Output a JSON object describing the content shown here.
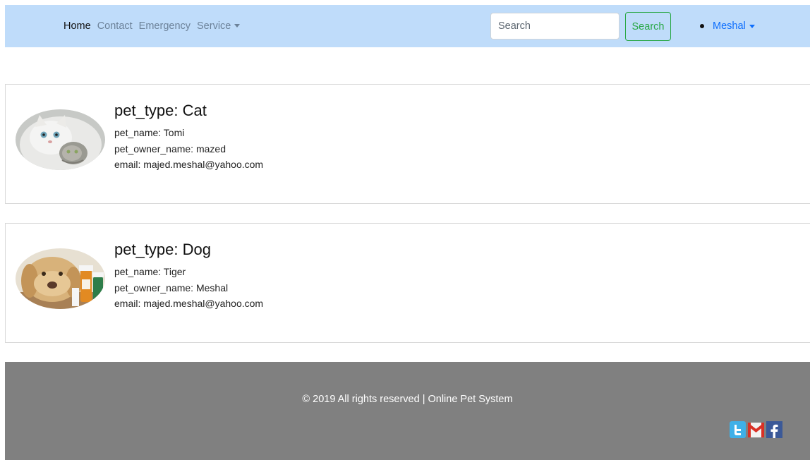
{
  "navbar": {
    "links": [
      {
        "label": "Home"
      },
      {
        "label": "Contact"
      },
      {
        "label": "Emergency"
      },
      {
        "label": "Service"
      }
    ],
    "search": {
      "placeholder": "Search",
      "button_label": "Search"
    },
    "user": {
      "name": "Meshal"
    }
  },
  "pets": [
    {
      "title": "pet_type: Cat",
      "pet_name": "pet_name: Tomi",
      "owner": "pet_owner_name: mazed",
      "email": "email: majed.meshal@yahoo.com",
      "image_icon": "cat-photo"
    },
    {
      "title": "pet_type: Dog",
      "pet_name": "pet_name: Tiger",
      "owner": "pet_owner_name: Meshal",
      "email": "email: majed.meshal@yahoo.com",
      "image_icon": "dog-photo"
    }
  ],
  "footer": {
    "copyright": "© 2019 All rights reserved | Online Pet System",
    "social": [
      "twitter-icon",
      "gmail-icon",
      "facebook-icon"
    ]
  },
  "colors": {
    "navbar_bg": "#bfdcfa",
    "footer_bg": "#808080",
    "search_button": "#28a745",
    "user_link": "#0d6efd"
  }
}
